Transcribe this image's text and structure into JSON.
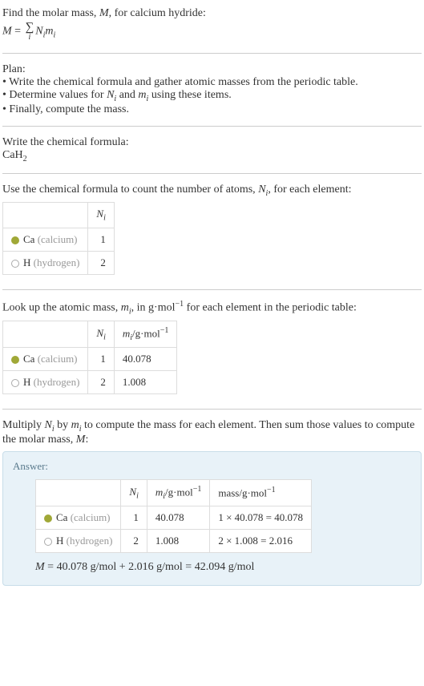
{
  "intro": {
    "line1_a": "Find the molar mass, ",
    "line1_b": ", for calcium hydride:",
    "M": "M",
    "eq_lhs": "M",
    "eq_eq": " = ",
    "sigma": "∑",
    "sigma_idx": "i",
    "eq_rhs_a": "N",
    "eq_rhs_b": "m"
  },
  "plan": {
    "title": "Plan:",
    "b1_a": "• Write the chemical formula and gather atomic masses from the periodic table.",
    "b2_a": "• Determine values for ",
    "b2_b": " and ",
    "b2_c": " using these items.",
    "b3": "• Finally, compute the mass.",
    "Ni_N": "N",
    "Ni_i": "i",
    "mi_m": "m",
    "mi_i": "i"
  },
  "formula": {
    "title": "Write the chemical formula:",
    "chem_a": "CaH",
    "chem_sub": "2"
  },
  "count": {
    "title_a": "Use the chemical formula to count the number of atoms, ",
    "title_b": ", for each element:",
    "Ni_N": "N",
    "Ni_i": "i",
    "hdr_Ni_N": "N",
    "hdr_Ni_i": "i",
    "ca_sym": "Ca",
    "ca_name": " (calcium)",
    "ca_n": "1",
    "h_sym": "H",
    "h_name": " (hydrogen)",
    "h_n": "2"
  },
  "mass": {
    "title_a": "Look up the atomic mass, ",
    "title_b": ", in g·mol",
    "title_c": " for each element in the periodic table:",
    "mi_m": "m",
    "mi_i": "i",
    "exp": "−1",
    "hdr_Ni_N": "N",
    "hdr_Ni_i": "i",
    "hdr_mi_m": "m",
    "hdr_mi_i": "i",
    "hdr_unit_a": "/g·mol",
    "hdr_unit_exp": "−1",
    "ca_sym": "Ca",
    "ca_name": " (calcium)",
    "ca_n": "1",
    "ca_m": "40.078",
    "h_sym": "H",
    "h_name": " (hydrogen)",
    "h_n": "2",
    "h_m": "1.008"
  },
  "compute": {
    "title_a": "Multiply ",
    "title_b": " by ",
    "title_c": " to compute the mass for each element. Then sum those values to compute the molar mass, ",
    "title_d": ":",
    "Ni_N": "N",
    "Ni_i": "i",
    "mi_m": "m",
    "mi_i": "i",
    "M": "M"
  },
  "answer": {
    "label": "Answer:",
    "hdr_Ni_N": "N",
    "hdr_Ni_i": "i",
    "hdr_mi_m": "m",
    "hdr_mi_i": "i",
    "hdr_unit_a": "/g·mol",
    "hdr_unit_exp": "−1",
    "hdr_mass_a": "mass/g·mol",
    "hdr_mass_exp": "−1",
    "ca_sym": "Ca",
    "ca_name": " (calcium)",
    "ca_n": "1",
    "ca_m": "40.078",
    "ca_mass": "1 × 40.078 = 40.078",
    "h_sym": "H",
    "h_name": " (hydrogen)",
    "h_n": "2",
    "h_m": "1.008",
    "h_mass": "2 × 1.008 = 2.016",
    "final_M": "M",
    "final_rest": " = 40.078 g/mol + 2.016 g/mol = 42.094 g/mol"
  }
}
